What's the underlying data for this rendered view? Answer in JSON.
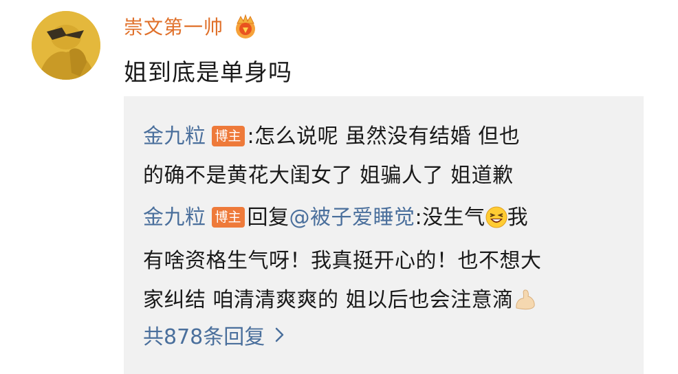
{
  "comment": {
    "username": "崇文第一帅",
    "text": "姐到底是单身吗"
  },
  "replies": [
    {
      "author": "金九粒",
      "badge": "博主",
      "separator": ":",
      "line1": "怎么说呢 虽然没有结婚 但也",
      "line2": "的确不是黄花大闺女了 姐骗人了 姐道歉"
    },
    {
      "author": "金九粒",
      "badge": "博主",
      "reply_prefix": "回复",
      "reply_to": "@被子爱睡觉",
      "text_start": ":没生气",
      "text_after_emoji": "我",
      "line2": "有啥资格生气呀！我真挺开心的！也不想大",
      "line3": "家纠结 咱清清爽爽的 姐以后也会注意滴"
    }
  ],
  "more_replies": "共878条回复",
  "icons": {
    "avatar": "avatar",
    "crown": "crown-icon",
    "laugh_emoji": "laughing-emoji-icon",
    "muscle_emoji": "flexed-arm-emoji-icon",
    "chevron": "chevron-right-icon"
  },
  "colors": {
    "username": "#e0702a",
    "link": "#4a6f9c",
    "badge": "#ee7a3a",
    "reply_background": "#f1f1f1"
  }
}
